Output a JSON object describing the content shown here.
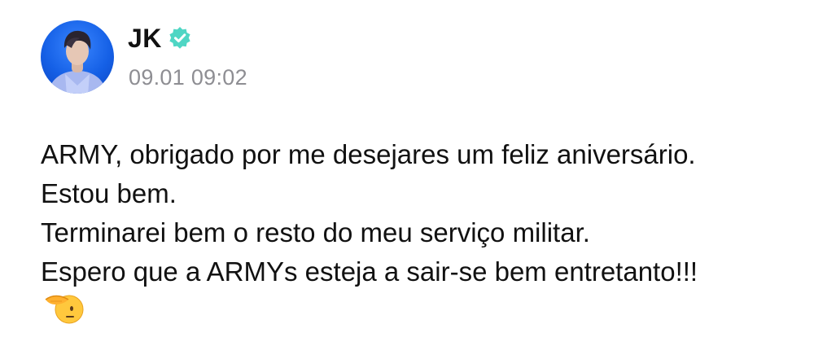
{
  "post": {
    "author": "JK",
    "verified_icon": "verified-badge-icon",
    "timestamp": "09.01 09:02",
    "avatar_icon": "profile-photo-avatar",
    "message_lines": [
      "ARMY, obrigado por me desejares um feliz aniversário.",
      "Estou bem.",
      "Terminarei bem o resto do meu serviço militar.",
      "Espero que a ARMYs esteja a sair-se bem entretanto!!!"
    ],
    "emoji_icon": "saluting-face-emoji-icon"
  },
  "colors": {
    "verified": "#4fd6c4",
    "timestamp": "#8e8e93",
    "text": "#111111",
    "avatar_bg": "#1560e6"
  }
}
